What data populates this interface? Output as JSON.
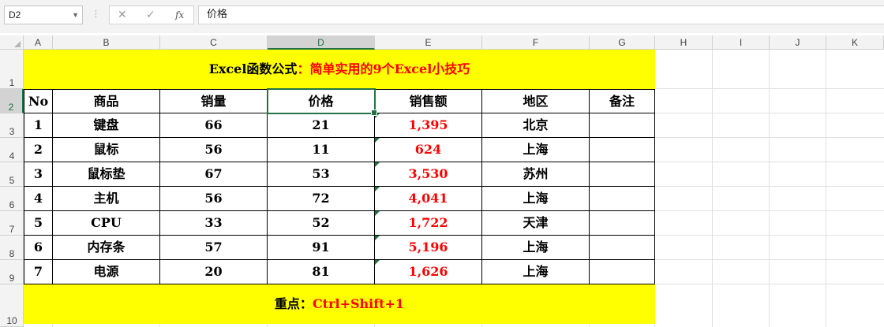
{
  "formula_bar": {
    "name_box": "D2",
    "cancel_icon": "✕",
    "enter_icon": "✓",
    "fx_label": "fx",
    "content": "价格"
  },
  "columns": [
    "A",
    "B",
    "C",
    "D",
    "E",
    "F",
    "G",
    "H",
    "I",
    "J",
    "K"
  ],
  "rows": [
    "1",
    "2",
    "3",
    "4",
    "5",
    "6",
    "7",
    "8",
    "9",
    "10"
  ],
  "title": {
    "part1": "Excel函数公式",
    "part2": "：简单实用的9个Excel小技巧"
  },
  "table": {
    "headers": [
      "No",
      "商品",
      "销量",
      "价格",
      "销售额",
      "地区",
      "备注"
    ],
    "rows": [
      [
        "1",
        "键盘",
        "66",
        "21",
        "1,395",
        "北京",
        ""
      ],
      [
        "2",
        "鼠标",
        "56",
        "11",
        "624",
        "上海",
        ""
      ],
      [
        "3",
        "鼠标垫",
        "67",
        "53",
        "3,530",
        "苏州",
        ""
      ],
      [
        "4",
        "主机",
        "56",
        "72",
        "4,041",
        "上海",
        ""
      ],
      [
        "5",
        "CPU",
        "33",
        "52",
        "1,722",
        "天津",
        ""
      ],
      [
        "6",
        "内存条",
        "57",
        "91",
        "5,196",
        "上海",
        ""
      ],
      [
        "7",
        "电源",
        "20",
        "81",
        "1,626",
        "上海",
        ""
      ]
    ]
  },
  "footer": {
    "part1": "重点：",
    "part2": "Ctrl+Shift+1"
  },
  "colors": {
    "banner": "#ffff00",
    "accent_red": "#ff0000",
    "excel_green": "#217346"
  }
}
